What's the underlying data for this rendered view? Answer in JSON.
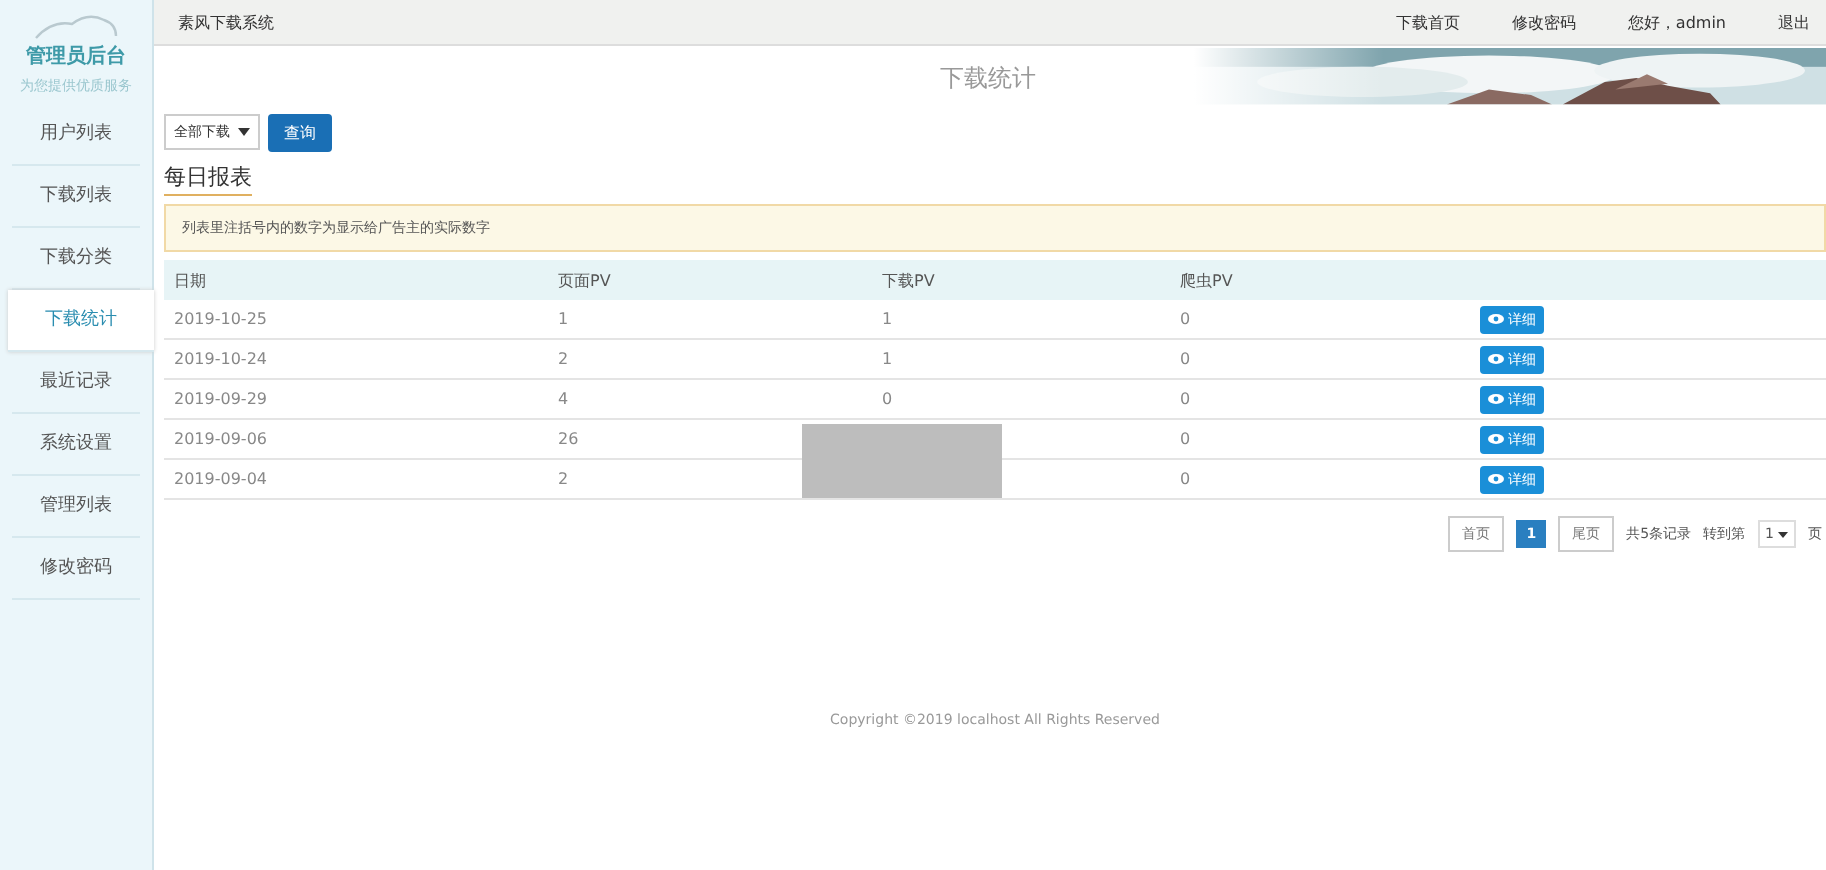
{
  "sidebar": {
    "title": "管理员后台",
    "subtitle": "为您提供优质服务",
    "items": [
      {
        "label": "用户列表",
        "selected": false
      },
      {
        "label": "下载列表",
        "selected": false
      },
      {
        "label": "下载分类",
        "selected": false
      },
      {
        "label": "下载统计",
        "selected": true
      },
      {
        "label": "最近记录",
        "selected": false
      },
      {
        "label": "系统设置",
        "selected": false
      },
      {
        "label": "管理列表",
        "selected": false
      },
      {
        "label": "修改密码",
        "selected": false
      }
    ]
  },
  "topbar": {
    "system_name": "素风下载系统",
    "links": [
      "下载首页",
      "修改密码",
      "您好，admin",
      "退出"
    ]
  },
  "banner": {
    "title": "下载统计",
    "kind": "picture"
  },
  "filter": {
    "select": "全部下载",
    "button": "查询"
  },
  "report": {
    "heading": "每日报表",
    "notice": "列表里注括号内的数字为显示给广告主的实际数字",
    "columns": [
      "日期",
      "页面PV",
      "下载PV",
      "爬虫PV"
    ],
    "rows": [
      {
        "date": "2019-10-25",
        "page_pv": "1",
        "download_pv": "1",
        "crawler_pv": "0",
        "action": "详细",
        "redacted": false
      },
      {
        "date": "2019-10-24",
        "page_pv": "2",
        "download_pv": "1",
        "crawler_pv": "0",
        "action": "详细",
        "redacted": false
      },
      {
        "date": "2019-09-29",
        "page_pv": "4",
        "download_pv": "0",
        "crawler_pv": "0",
        "action": "详细",
        "redacted": false
      },
      {
        "date": "2019-09-06",
        "page_pv": "26",
        "crawler_pv": "0",
        "action": "详细",
        "redacted": true
      },
      {
        "date": "2019-09-04",
        "page_pv": "2",
        "crawler_pv": "0",
        "action": "详细",
        "redacted": true
      }
    ]
  },
  "pagination": {
    "first": "首页",
    "pages": [
      {
        "label": "1",
        "selected": true
      }
    ],
    "last": "尾页",
    "total": "共5条记录",
    "goto": "转到第",
    "page_select": "1",
    "suffix": "页"
  },
  "footer": "Copyright ©2019 localhost All Rights Reserved"
}
